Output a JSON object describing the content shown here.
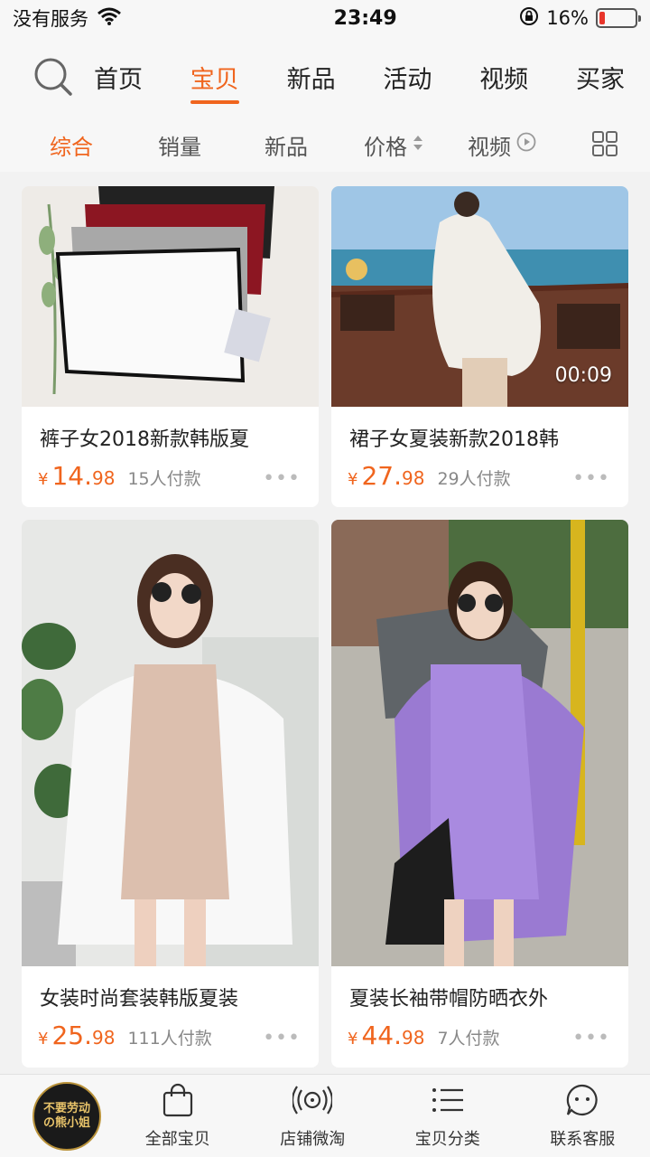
{
  "status": {
    "carrier": "没有服务",
    "time": "23:49",
    "battery": "16%",
    "battery_level": 0.16,
    "battery_color": "#e8352b"
  },
  "nav": {
    "tabs": [
      "首页",
      "宝贝",
      "新品",
      "活动",
      "视频",
      "买家"
    ],
    "active_index": 1
  },
  "sort": {
    "items": [
      "综合",
      "销量",
      "新品",
      "价格",
      "视频"
    ],
    "active_index": 0
  },
  "products": [
    {
      "title": "裤子女2018新款韩版夏",
      "yen": "¥",
      "price_int": "14.",
      "price_dec": "98",
      "paid": "15人付款",
      "duration": ""
    },
    {
      "title": "裙子女夏装新款2018韩",
      "yen": "¥",
      "price_int": "27.",
      "price_dec": "98",
      "paid": "29人付款",
      "duration": "00:09"
    },
    {
      "title": "女装时尚套装韩版夏装",
      "yen": "¥",
      "price_int": "25.",
      "price_dec": "98",
      "paid": "111人付款",
      "duration": ""
    },
    {
      "title": "夏装长袖带帽防晒衣外",
      "yen": "¥",
      "price_int": "44.",
      "price_dec": "98",
      "paid": "7人付款",
      "duration": ""
    }
  ],
  "bottom": {
    "logo_line1": "不要劳动",
    "logo_line2": "の熊小姐",
    "items": [
      "全部宝贝",
      "店铺微淘",
      "宝贝分类",
      "联系客服"
    ]
  },
  "colors": {
    "accent": "#f0651e"
  }
}
